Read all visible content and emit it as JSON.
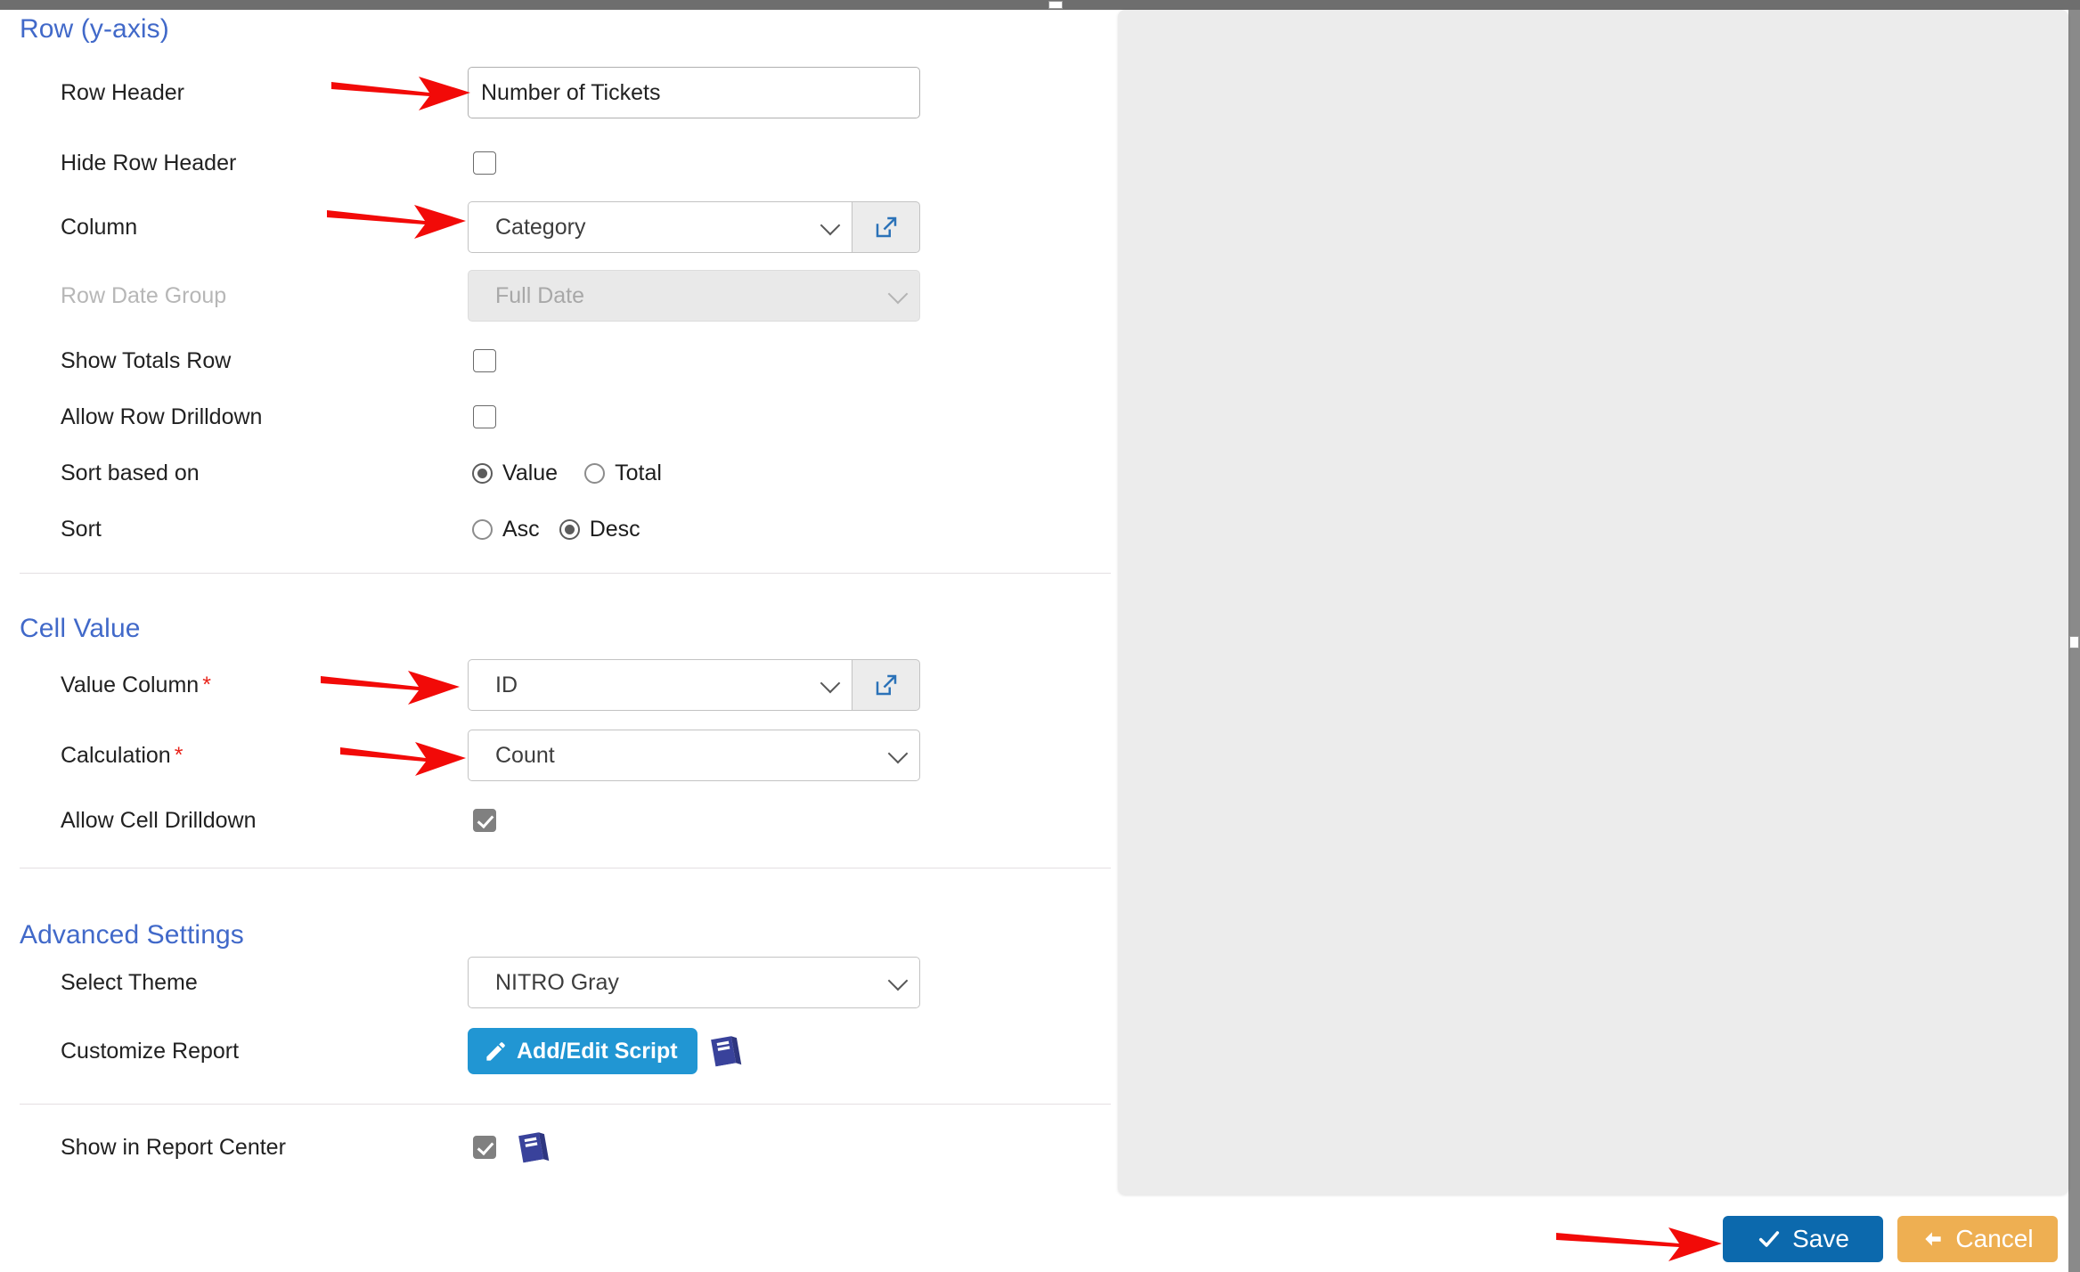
{
  "sections": {
    "row": {
      "title": "Row (y-axis)",
      "fields": {
        "row_header": {
          "label": "Row Header",
          "value": "Number of Tickets"
        },
        "hide_row_header": {
          "label": "Hide Row Header",
          "checked": false
        },
        "column": {
          "label": "Column",
          "value": "Category"
        },
        "row_date_group": {
          "label": "Row Date Group",
          "value": "Full Date",
          "disabled": true
        },
        "show_totals_row": {
          "label": "Show Totals Row",
          "checked": false
        },
        "allow_row_drilldown": {
          "label": "Allow Row Drilldown",
          "checked": false
        },
        "sort_based_on": {
          "label": "Sort based on",
          "options": [
            "Value",
            "Total"
          ],
          "selected": "Value"
        },
        "sort": {
          "label": "Sort",
          "options": [
            "Asc",
            "Desc"
          ],
          "selected": "Desc"
        }
      }
    },
    "cell_value": {
      "title": "Cell Value",
      "fields": {
        "value_column": {
          "label": "Value Column",
          "required": "*",
          "value": "ID"
        },
        "calculation": {
          "label": "Calculation",
          "required": "*",
          "value": "Count"
        },
        "allow_cell_drilldown": {
          "label": "Allow Cell Drilldown",
          "checked": true
        }
      }
    },
    "advanced": {
      "title": "Advanced Settings",
      "fields": {
        "select_theme": {
          "label": "Select Theme",
          "value": "NITRO Gray"
        },
        "customize_report": {
          "label": "Customize Report",
          "button_label": "Add/Edit Script"
        },
        "show_in_report_center": {
          "label": "Show in Report Center",
          "checked": true
        }
      }
    }
  },
  "footer": {
    "save_label": "Save",
    "cancel_label": "Cancel"
  },
  "icons": {
    "external_link": "external-link-icon",
    "chevron_down": "chevron-down-icon",
    "pencil": "pencil-icon",
    "book": "book-icon",
    "check": "check-icon",
    "back_arrow": "back-arrow-icon"
  },
  "colors": {
    "section_heading": "#4169c9",
    "required_marker": "#e8241b",
    "save_button": "#0c69ad",
    "cancel_button": "#eeaf52",
    "script_button": "#2196d3",
    "book_icon": "#39429b",
    "external_link_icon": "#2b72b8",
    "annotation_arrow": "#f20a08",
    "preview_panel": "#ececec"
  }
}
